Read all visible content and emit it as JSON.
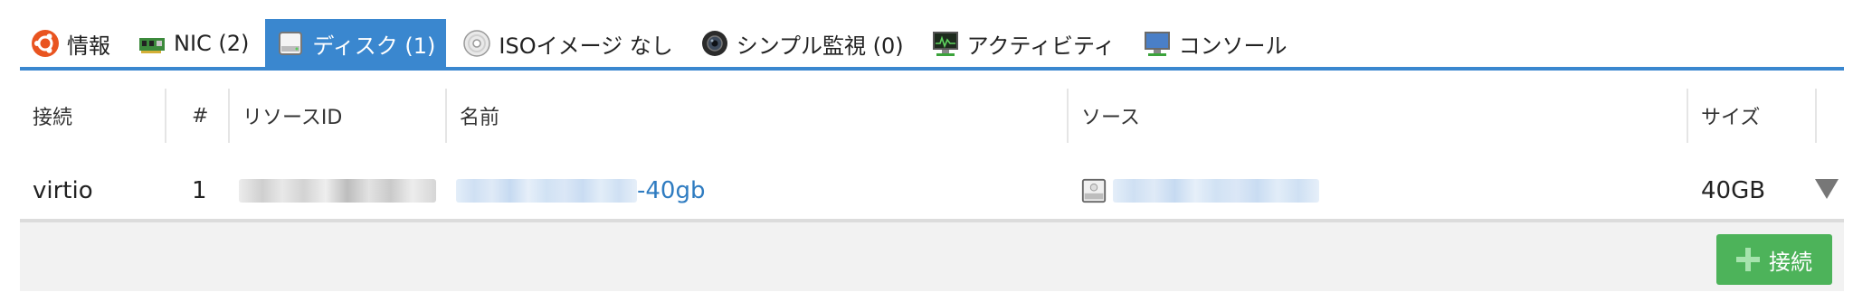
{
  "tabs": [
    {
      "label": "情報",
      "icon": "ubuntu-icon",
      "active": false
    },
    {
      "label": "NIC (2)",
      "icon": "nic-icon",
      "active": false
    },
    {
      "label": "ディスク (1)",
      "icon": "disk-icon",
      "active": true
    },
    {
      "label": "ISOイメージ なし",
      "icon": "cd-icon",
      "active": false
    },
    {
      "label": "シンプル監視 (0)",
      "icon": "camera-icon",
      "active": false
    },
    {
      "label": "アクティビティ",
      "icon": "activity-monitor-icon",
      "active": false
    },
    {
      "label": "コンソール",
      "icon": "console-monitor-icon",
      "active": false
    }
  ],
  "table": {
    "headers": {
      "connection": "接続",
      "index": "#",
      "resource_id": "リソースID",
      "name": "名前",
      "source": "ソース",
      "size": "サイズ"
    },
    "rows": [
      {
        "connection": "virtio",
        "index": "1",
        "name_suffix": "-40gb",
        "size": "40GB"
      }
    ]
  },
  "footer": {
    "connect_button": "接続"
  },
  "colors": {
    "accent": "#3a87cf",
    "link": "#2f7cc1",
    "button_green": "#4db35a"
  }
}
